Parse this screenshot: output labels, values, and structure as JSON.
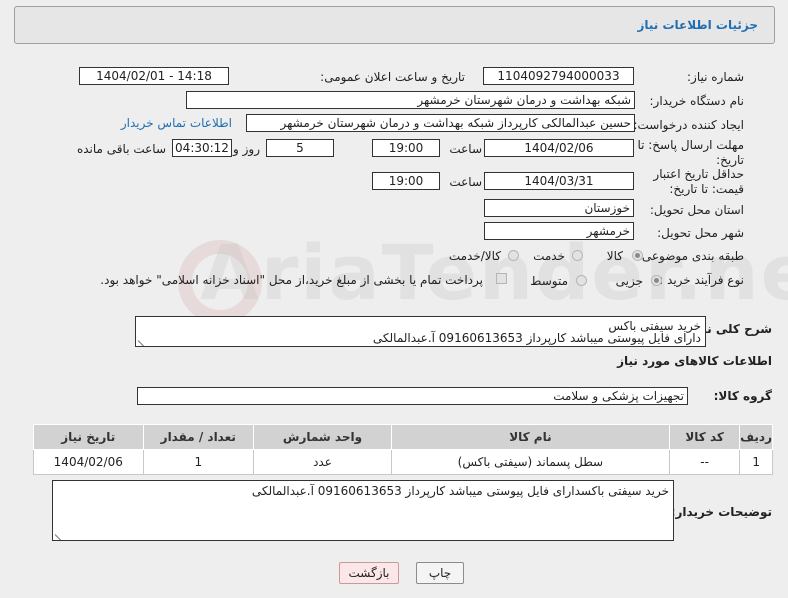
{
  "panel_title": "جزئیات اطلاعات نیاز",
  "fields": {
    "need_number_label": "شماره نیاز:",
    "need_number": "1104092794000033",
    "announce_label": "تاریخ و ساعت اعلان عمومی:",
    "announce_value": "1404/02/01 - 14:18",
    "buyer_org_label": "نام دستگاه خریدار:",
    "buyer_org": "شبکه بهداشت و درمان شهرستان خرمشهر",
    "requester_label": "ایجاد کننده درخواست:",
    "requester": "حسین عبدالمالکی کارپرداز شبکه بهداشت و درمان شهرستان خرمشهر",
    "contact_link": "اطلاعات تماس خریدار",
    "deadline_label": "مهلت ارسال پاسخ: تا تاریخ:",
    "deadline_date": "1404/02/06",
    "time_label": "ساعت",
    "deadline_time": "19:00",
    "days_value": "5",
    "days_label": "روز و",
    "remaining_value": "04:30:12",
    "remaining_label": "ساعت باقی مانده",
    "validity_label": "حداقل تاریخ اعتبار قیمت: تا تاریخ:",
    "validity_date": "1404/03/31",
    "validity_time": "19:00",
    "province_label": "استان محل تحویل:",
    "province": "خوزستان",
    "city_label": "شهر محل تحویل:",
    "city": "خرمشهر",
    "category_label": "طبقه بندی موضوعی:",
    "category_options": [
      "کالا",
      "خدمت",
      "کالا/خدمت"
    ],
    "process_label": "نوع فرآیند خرید :",
    "process_options": [
      "جزیی",
      "متوسط"
    ],
    "payment_note": "پرداخت تمام یا بخشی از مبلغ خرید،از محل \"اسناد خزانه اسلامی\" خواهد بود."
  },
  "summary": {
    "label": "شرح کلی نیاز:",
    "line1": "خرید سیفتی باکس",
    "line2": "دارای فایل پیوستی میباشد کارپرداز 09160613653 آ.عبدالمالکی"
  },
  "goods_section_title": "اطلاعات کالاهای مورد نیاز",
  "goods_group": {
    "label": "گروه کالا:",
    "value": "تجهیزات پزشکی و سلامت"
  },
  "table": {
    "headers": [
      "ردیف",
      "کد کالا",
      "نام کالا",
      "واحد شمارش",
      "تعداد / مقدار",
      "تاریخ نیاز"
    ],
    "rows": [
      [
        "1",
        "--",
        "سطل پسماند (سیفتی باکس)",
        "عدد",
        "1",
        "1404/02/06"
      ]
    ]
  },
  "buyer_notes": {
    "label": "توضیحات خریدار:",
    "value": "خرید سیفتی باکسدارای فایل پیوستی میباشد کارپرداز 09160613653 آ.عبدالمالکی"
  },
  "buttons": {
    "print": "چاپ",
    "back": "بازگشت"
  },
  "watermark": "AriaTender.neT"
}
